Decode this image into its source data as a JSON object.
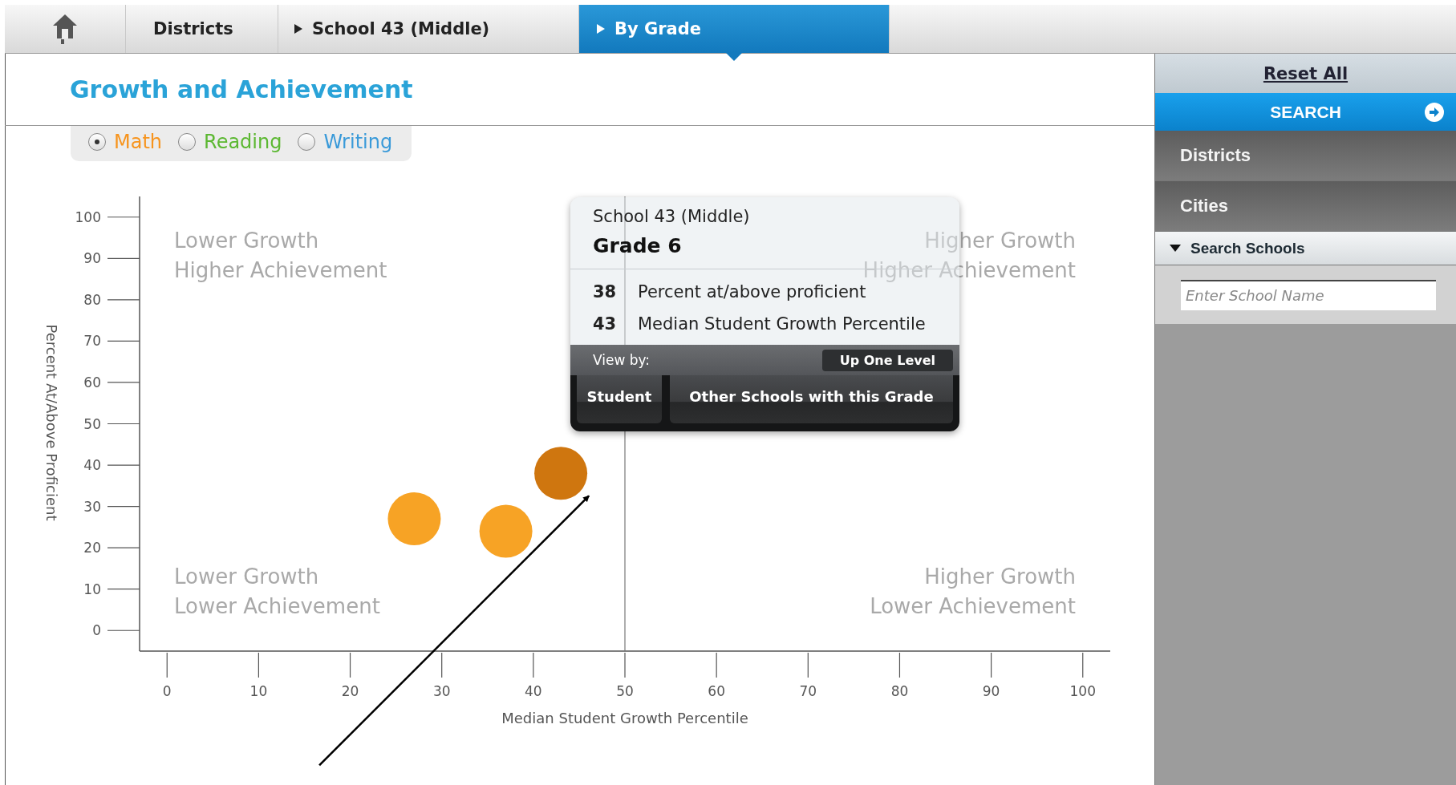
{
  "breadcrumbs": [
    {
      "kind": "home",
      "selected": false
    },
    {
      "kind": "link",
      "label": "Districts",
      "selected": false
    },
    {
      "kind": "crumb",
      "label": "School 43 (Middle)",
      "selected": false
    },
    {
      "kind": "crumb",
      "label": "By Grade",
      "selected": true
    }
  ],
  "title": "Growth and Achievement",
  "subjects": [
    {
      "label": "Math",
      "selected": true,
      "color": "#f7941d"
    },
    {
      "label": "Reading",
      "selected": false,
      "color": "#5cb832"
    },
    {
      "label": "Writing",
      "selected": false,
      "color": "#3a9ad9"
    }
  ],
  "quadrant_labels": [
    {
      "kind": "top-left",
      "lines": [
        "Lower Growth",
        "Higher Achievement"
      ]
    },
    {
      "kind": "top-right",
      "lines": [
        "Higher Growth",
        "Higher Achievement"
      ]
    },
    {
      "kind": "bottom-left",
      "lines": [
        "Lower Growth",
        "Lower Achievement"
      ]
    },
    {
      "kind": "bottom-right",
      "lines": [
        "Higher Growth",
        "Lower Achievement"
      ]
    }
  ],
  "chart_data": {
    "type": "scatter",
    "xlabel": "Median Student Growth Percentile",
    "ylabel": "Percent At/Above Proficient",
    "xlim": [
      -3,
      103
    ],
    "ylim": [
      -5,
      105
    ],
    "xticks": [
      0,
      10,
      20,
      30,
      40,
      50,
      60,
      70,
      80,
      90,
      100
    ],
    "yticks": [
      0,
      10,
      20,
      30,
      40,
      50,
      60,
      70,
      80,
      90,
      100
    ],
    "series": [
      {
        "color": "#f7a325",
        "x": [
          27,
          37
        ],
        "values": [
          27,
          24
        ]
      },
      {
        "color": "#cf760f",
        "x": [
          43
        ],
        "values": [
          38
        ]
      }
    ],
    "ref_lines": [
      {
        "axis": "x",
        "value": 50
      }
    ]
  },
  "pointer_arrow": {
    "kind": "arrow"
  },
  "tooltip": {
    "school": "School 43 (Middle)",
    "grade": "Grade 6",
    "stats": [
      {
        "value": "38",
        "label": "Percent at/above proficient"
      },
      {
        "value": "43",
        "label": "Median Student Growth Percentile"
      }
    ],
    "view_by": "View by:",
    "up_button": "Up One Level",
    "buttons": [
      "Student",
      "Other Schools with this Grade"
    ]
  },
  "sidebar": {
    "reset": "Reset All",
    "search": "SEARCH",
    "sections": [
      {
        "label": "Districts",
        "expanded": false
      },
      {
        "label": "Cities",
        "expanded": false
      },
      {
        "label": "Search Schools",
        "expanded": true
      }
    ],
    "school_field": {
      "placeholder": "Enter School Name"
    }
  }
}
